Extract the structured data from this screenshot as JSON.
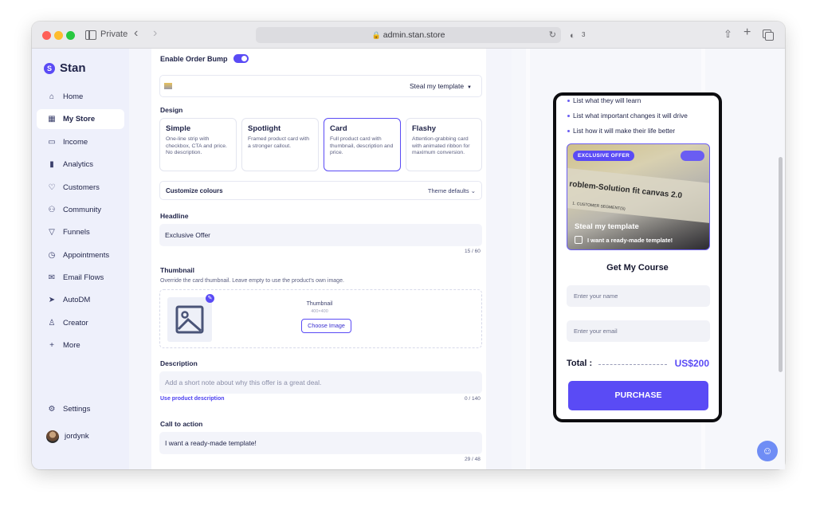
{
  "browser": {
    "private_label": "Private",
    "url": "admin.stan.store",
    "shield_count": "3"
  },
  "sidebar": {
    "brand": "Stan",
    "items": [
      {
        "label": "Home",
        "icon": "home-icon"
      },
      {
        "label": "My Store",
        "icon": "store-icon",
        "active": true
      },
      {
        "label": "Income",
        "icon": "wallet-icon"
      },
      {
        "label": "Analytics",
        "icon": "chart-icon"
      },
      {
        "label": "Customers",
        "icon": "heart-icon"
      },
      {
        "label": "Community",
        "icon": "people-icon"
      },
      {
        "label": "Funnels",
        "icon": "funnel-icon"
      },
      {
        "label": "Appointments",
        "icon": "clock-icon"
      },
      {
        "label": "Email Flows",
        "icon": "mail-icon"
      },
      {
        "label": "AutoDM",
        "icon": "send-icon"
      },
      {
        "label": "Creator",
        "icon": "user-icon"
      },
      {
        "label": "More",
        "icon": "plus-icon"
      }
    ],
    "settings": "Settings",
    "user": "jordynk"
  },
  "editor": {
    "order_bump_label": "Enable Order Bump",
    "template_select": "Steal my template",
    "design_label": "Design",
    "design_cards": [
      {
        "title": "Simple",
        "desc": "One-line strip with checkbox, CTA and price. No description."
      },
      {
        "title": "Spotlight",
        "desc": "Framed product card with a stronger callout."
      },
      {
        "title": "Card",
        "desc": "Full product card with thumbnail, description and price.",
        "selected": true
      },
      {
        "title": "Flashy",
        "desc": "Attention-grabbing card with animated ribbon for maximum conversion."
      }
    ],
    "customize_colours": "Customize colours",
    "theme_defaults": "Theme defaults",
    "headline_label": "Headline",
    "headline_value": "Exclusive Offer",
    "headline_counter": "15 / 60",
    "thumbnail_label": "Thumbnail",
    "thumbnail_help": "Override the card thumbnail. Leave empty to use the product's own image.",
    "thumbnail_caption": "Thumbnail",
    "thumbnail_size": "400×400",
    "choose_image": "Choose Image",
    "description_label": "Description",
    "description_placeholder": "Add a short note about why this offer is a great deal.",
    "use_product_description": "Use product description",
    "description_counter": "0 / 140",
    "cta_label": "Call to action",
    "cta_value": "I want a ready-made template!",
    "cta_counter": "29 / 48"
  },
  "preview": {
    "bullets": [
      "List what they will learn",
      "List what important changes it will drive",
      "List how it will make their life better"
    ],
    "offer_badge": "EXCLUSIVE OFFER",
    "offer_image_text": "roblem-Solution fit canvas 2.0",
    "offer_image_sub": "1. CUSTOMER SEGMENT(S)",
    "offer_title": "Steal my template",
    "offer_cta": "I want a ready-made template!",
    "course_title": "Get My Course",
    "name_placeholder": "Enter your name",
    "email_placeholder": "Enter your email",
    "total_label": "Total :",
    "total_amount": "US$200",
    "purchase": "PURCHASE"
  },
  "colors": {
    "accent": "#5a4bf5",
    "sidebar_bg": "#eef0fb"
  }
}
